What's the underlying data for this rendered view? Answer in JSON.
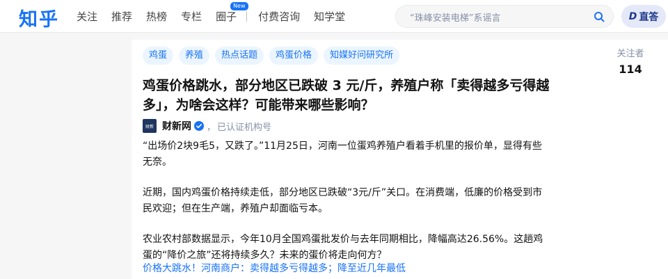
{
  "header": {
    "logo": "知乎",
    "nav": [
      "关注",
      "推荐",
      "热榜",
      "专栏",
      "圈子",
      "付费咨询",
      "知学堂"
    ],
    "new_badge": "New",
    "search_placeholder": "“珠峰安装电梯”系谣言",
    "answer_button": "直答"
  },
  "question": {
    "tags": [
      "鸡蛋",
      "养殖",
      "热点话题",
      "鸡蛋价格",
      "知媒好问研究所"
    ],
    "followers_label": "关注者",
    "followers_count": "114",
    "title": "鸡蛋价格跳水，部分地区已跌破 3 元/斤，养殖户称「卖得越多亏得越多」，为啥会这样？可能带来哪些影响？",
    "author": {
      "avatar_text": "财新",
      "name": "财新网",
      "separator": "，",
      "org": "已认证机构号"
    },
    "paragraphs": [
      "“出场价2块9毛5，又跌了。”11月25日，河南一位蛋鸡养殖户看着手机里的报价单，显得有些无奈。",
      "近期，国内鸡蛋价格持续走低，部分地区已跌破“3元/斤”关口。在消费端，低廉的价格受到市民欢迎；但在生产端，养殖户却面临亏本。",
      "农业农村部数据显示，今年10月全国鸡蛋批发价与去年同期相比，降幅高达26.56%。这趟鸡蛋的“降价之旅”还将持续多久？未来的蛋价将走向何方？"
    ],
    "related_link": "价格大跳水！河南商户：卖得越多亏得越多；降至近几年最低"
  },
  "colors": {
    "brand": "#1772f6",
    "tag_bg": "#ebf5ff",
    "answer_bg": "#e4e8f8"
  },
  "icons": [
    "search-icon",
    "verified-icon",
    "direct-answer-icon"
  ]
}
